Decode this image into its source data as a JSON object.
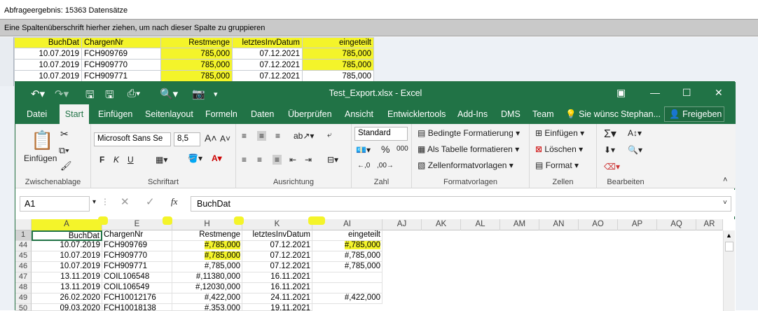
{
  "background": {
    "status": "Abfrageergebnis: 15363 Datensätze",
    "group_hint": "Eine Spaltenüberschrift hierher ziehen, um nach dieser Spalte zu gruppieren",
    "headers": [
      "BuchDat",
      "ChargenNr",
      "Restmenge",
      "letztesInvDatum",
      "eingeteilt"
    ],
    "rows": [
      [
        "10.07.2019",
        "FCH909769",
        "785,000",
        "07.12.2021",
        "785,000"
      ],
      [
        "10.07.2019",
        "FCH909770",
        "785,000",
        "07.12.2021",
        "785,000"
      ],
      [
        "10.07.2019",
        "FCH909771",
        "785,000",
        "07.12.2021",
        "785,000"
      ]
    ]
  },
  "excel": {
    "title": "Test_Export.xlsx - Excel",
    "tabs": [
      "Datei",
      "Start",
      "Einfügen",
      "Seitenlayout",
      "Formeln",
      "Daten",
      "Überprüfen",
      "Ansicht",
      "Entwicklertools",
      "Add-Ins",
      "DMS",
      "Team"
    ],
    "tell_me": "Sie wünsc",
    "user": "Stephan...",
    "share": "Freigeben",
    "ribbon": {
      "paste": "Einfügen",
      "clipboard": "Zwischenablage",
      "font_name": "Microsoft Sans Se",
      "font_size": "8,5",
      "bold": "F",
      "italic": "K",
      "underline": "U",
      "font_group": "Schriftart",
      "align_group": "Ausrichtung",
      "number_format": "Standard",
      "percent": "%",
      "thousands": "000",
      "number_group": "Zahl",
      "cond_format": "Bedingte Formatierung",
      "as_table": "Als Tabelle formatieren",
      "cell_styles": "Zellenformatvorlagen",
      "styles_group": "Formatvorlagen",
      "insert": "Einfügen",
      "delete": "Löschen",
      "format": "Format",
      "cells_group": "Zellen",
      "edit_group": "Bearbeiten"
    },
    "name_box": "A1",
    "formula": "BuchDat",
    "columns": [
      "A",
      "E",
      "H",
      "K",
      "AI",
      "AJ",
      "AK",
      "AL",
      "AM",
      "AN",
      "AO",
      "AP",
      "AQ",
      "AR"
    ],
    "row_numbers": [
      "1",
      "44",
      "45",
      "46",
      "47",
      "48",
      "49",
      "50"
    ],
    "rows": [
      [
        "BuchDat",
        "ChargenNr",
        "Restmenge",
        "letztesInvDatum",
        "eingeteilt"
      ],
      [
        "10.07.2019",
        "FCH909769",
        "#,785,000",
        "07.12.2021",
        "#,785,000"
      ],
      [
        "10.07.2019",
        "FCH909770",
        "#,785,000",
        "07.12.2021",
        "#,785,000"
      ],
      [
        "10.07.2019",
        "FCH909771",
        "#,785,000",
        "07.12.2021",
        "#,785,000"
      ],
      [
        "13.11.2019",
        "COIL106548",
        "#,11380,000",
        "16.11.2021",
        ""
      ],
      [
        "13.11.2019",
        "COIL106549",
        "#,12030,000",
        "16.11.2021",
        ""
      ],
      [
        "26.02.2020",
        "FCH10012176",
        "#,422,000",
        "24.11.2021",
        "#,422,000"
      ],
      [
        "09.03.2020",
        "FCH10018138",
        "#,353,000",
        "19.11.2021",
        ""
      ]
    ]
  }
}
